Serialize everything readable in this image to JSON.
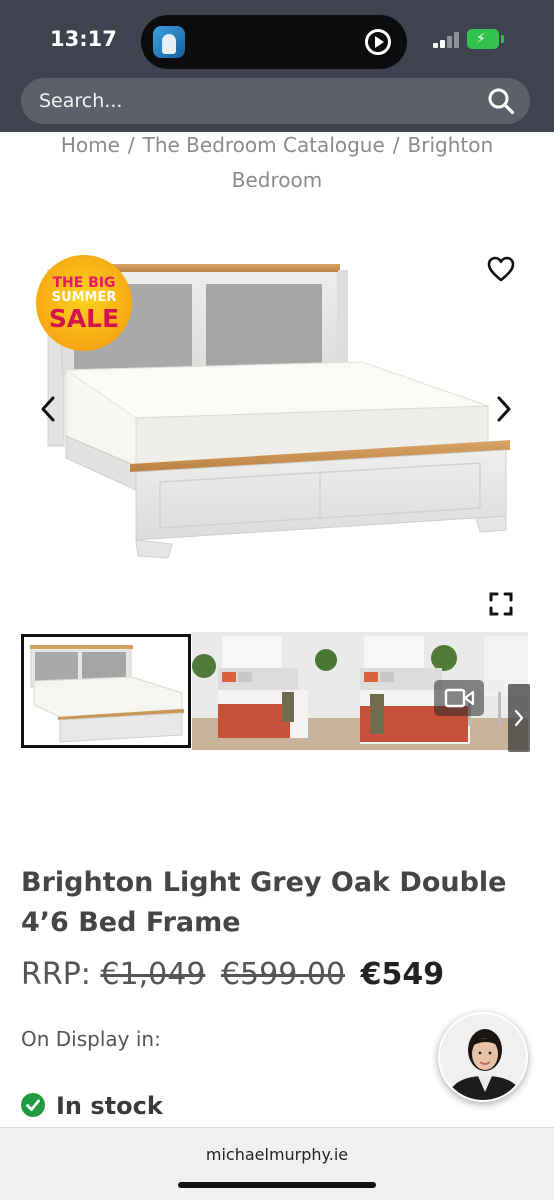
{
  "status": {
    "time": "13:17",
    "battery_color": "#33c24d"
  },
  "search": {
    "placeholder": "Search..."
  },
  "breadcrumb": {
    "home": "Home",
    "separator": "/",
    "catalogue": "The Bedroom Catalogue",
    "current": "Brighton Bedroom"
  },
  "badge": {
    "line1": "THE BIG",
    "line2": "SUMMER",
    "line3": "SALE"
  },
  "icons": {
    "wishlist": "heart-icon",
    "prev": "chevron-left-icon",
    "next": "chevron-right-icon",
    "fullscreen": "expand-icon",
    "video": "video-camera-icon",
    "stock": "check-circle-icon"
  },
  "product": {
    "title": "Brighton Light Grey Oak Double 4’6 Bed Frame",
    "rrp_label": "RRP:",
    "rrp_price": "€1,049",
    "was_price": "€599.00",
    "price": "€549",
    "on_display_label": "On Display in:",
    "stock_label": "In stock"
  },
  "colors": {
    "header_bg": "#3f4350",
    "sale_pink": "#e8176b",
    "stock_green": "#1e9b3e"
  },
  "browser": {
    "url": "michaelmurphy.ie"
  }
}
